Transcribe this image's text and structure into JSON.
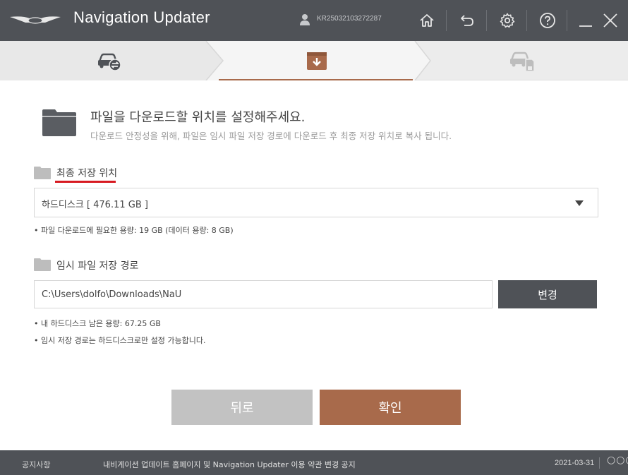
{
  "titlebar": {
    "app_title": "Navigation Updater",
    "user_id": "KR25032103272287",
    "icons": [
      "logo-icon",
      "user-icon",
      "home-icon",
      "back-icon",
      "gear-icon",
      "help-icon",
      "minimize-icon",
      "close-icon"
    ]
  },
  "stepper": {
    "steps": [
      {
        "icon": "car-sync-icon",
        "state": "inactive"
      },
      {
        "icon": "download-box-icon",
        "state": "active"
      },
      {
        "icon": "car-sdcard-icon",
        "state": "disabled"
      }
    ],
    "active_color": "#a86a4b"
  },
  "main": {
    "title": "파일을 다운로드할 위치를 설정해주세요.",
    "subtitle": "다운로드 안정성을 위해, 파일은 임시 파일 저장 경로에 다운로드 후 최종 저장 위치로 복사 됩니다.",
    "final_location": {
      "label": "최종 저장 위치",
      "selected": "하드디스크 [ 476.11 GB ]",
      "note": "• 파일 다운로드에 필요한 용량: 19 GB (데이터 용량: 8 GB)"
    },
    "temp_path": {
      "label": "임시 파일 저장 경로",
      "value": "C:\\Users\\dolfo\\Downloads\\NaU",
      "change_label": "변경",
      "note1": "• 내 하드디스크 남은 용량: 67.25 GB",
      "note2": "• 임시 저장 경로는 하드디스크로만 설정 가능합니다."
    },
    "back_label": "뒤로",
    "confirm_label": "확인"
  },
  "footer": {
    "notice_label": "공지사항",
    "notice_text": "내비게이션 업데이트 홈페이지 및 Navigation Updater 이용 약관 변경 공지",
    "date": "2021-03-31",
    "more": "○○○"
  },
  "colors": {
    "titlebar": "#4f5257",
    "accent": "#a86a4b",
    "underline_red": "#d71920"
  }
}
